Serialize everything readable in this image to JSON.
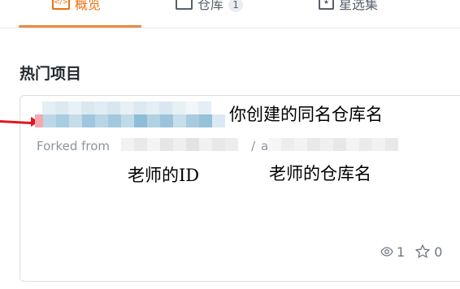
{
  "tabs": [
    {
      "label": "概览",
      "icon": "code-icon",
      "active": true
    },
    {
      "label": "仓库",
      "icon": "repo-icon",
      "count": "1"
    },
    {
      "label": "星选集",
      "icon": "star-box-icon"
    }
  ],
  "section": {
    "title": "热门项目"
  },
  "card": {
    "forked_from": "Forked from",
    "slash": "/",
    "slash_partial": "a",
    "watchers": "1",
    "stars": "0"
  },
  "annotations": {
    "own_repo": "你创建的同名仓库名",
    "teacher_id": "老师的ID",
    "teacher_repo": "老师的仓库名"
  },
  "colors": {
    "accent": "#f0700f",
    "annotation_arrow": "#e0181f",
    "muted_text": "#8c959f"
  }
}
